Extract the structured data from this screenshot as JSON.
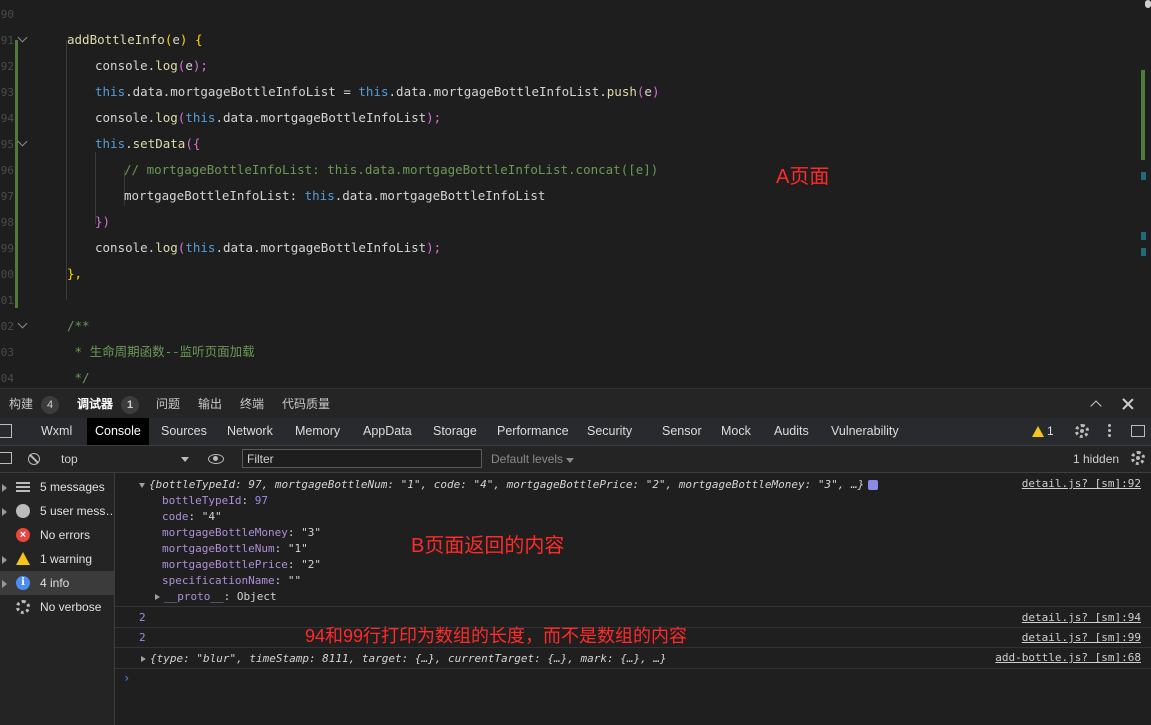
{
  "editor": {
    "line_numbers": [
      "90",
      "91",
      "92",
      "93",
      "94",
      "95",
      "96",
      "97",
      "98",
      "99",
      "00",
      "01",
      "02",
      "03",
      "04"
    ],
    "lines": [
      {
        "segments": [
          {
            "t": "addBottleInfo",
            "c": "fn"
          },
          {
            "t": "(",
            "c": "br1"
          },
          {
            "t": "e",
            "c": "pm"
          },
          {
            "t": ") ",
            "c": "br1"
          },
          {
            "t": "{",
            "c": "br1"
          }
        ]
      },
      {
        "segments": [
          {
            "t": "console.",
            "c": "plain"
          },
          {
            "t": "log",
            "c": "fn"
          },
          {
            "t": "(",
            "c": "br2"
          },
          {
            "t": "e",
            "c": "pm"
          },
          {
            "t": ");",
            "c": "br2"
          }
        ]
      },
      {
        "segments": [
          {
            "t": "this",
            "c": "kw"
          },
          {
            "t": ".data.mortgageBottleInfoList = ",
            "c": "plain"
          },
          {
            "t": "this",
            "c": "kw"
          },
          {
            "t": ".data.mortgageBottleInfoList.",
            "c": "plain"
          },
          {
            "t": "push",
            "c": "fn"
          },
          {
            "t": "(",
            "c": "br2"
          },
          {
            "t": "e",
            "c": "pm"
          },
          {
            "t": ")",
            "c": "br2"
          }
        ]
      },
      {
        "segments": [
          {
            "t": "console.",
            "c": "plain"
          },
          {
            "t": "log",
            "c": "fn"
          },
          {
            "t": "(",
            "c": "br2"
          },
          {
            "t": "this",
            "c": "kw"
          },
          {
            "t": ".data.mortgageBottleInfoList",
            "c": "plain"
          },
          {
            "t": ");",
            "c": "br2"
          }
        ]
      },
      {
        "segments": [
          {
            "t": "this",
            "c": "kw"
          },
          {
            "t": ".",
            "c": "plain"
          },
          {
            "t": "setData",
            "c": "fn"
          },
          {
            "t": "({",
            "c": "br2"
          }
        ]
      },
      {
        "segments": [
          {
            "t": "// mortgageBottleInfoList: this.data.mortgageBottleInfoList.concat([e])",
            "c": "cm"
          }
        ]
      },
      {
        "segments": [
          {
            "t": "mortgageBottleInfoList: ",
            "c": "plain"
          },
          {
            "t": "this",
            "c": "kw"
          },
          {
            "t": ".data.mortgageBottleInfoList",
            "c": "plain"
          }
        ]
      },
      {
        "segments": [
          {
            "t": "})",
            "c": "br2"
          }
        ]
      },
      {
        "segments": [
          {
            "t": "console.",
            "c": "plain"
          },
          {
            "t": "log",
            "c": "fn"
          },
          {
            "t": "(",
            "c": "br2"
          },
          {
            "t": "this",
            "c": "kw"
          },
          {
            "t": ".data.mortgageBottleInfoList",
            "c": "plain"
          },
          {
            "t": ");",
            "c": "br2"
          }
        ]
      },
      {
        "segments": [
          {
            "t": "},",
            "c": "br1"
          }
        ]
      },
      {
        "segments": [
          {
            "t": "",
            "c": "plain"
          }
        ]
      },
      {
        "segments": [
          {
            "t": "/**",
            "c": "cm"
          }
        ]
      },
      {
        "segments": [
          {
            "t": " * 生命周期函数--监听页面加载",
            "c": "cm"
          }
        ]
      },
      {
        "segments": [
          {
            "t": " */",
            "c": "cm"
          }
        ]
      }
    ],
    "annotation": "A页面"
  },
  "tooltabs": {
    "build": "构建",
    "build_count": "4",
    "debugger": "调试器",
    "debugger_count": "1",
    "problems": "问题",
    "output": "输出",
    "terminal": "终端",
    "quality": "代码质量"
  },
  "devtabs": {
    "items": [
      "Wxml",
      "Console",
      "Sources",
      "Network",
      "Memory",
      "AppData",
      "Storage",
      "Performance",
      "Security",
      "Sensor",
      "Mock",
      "Audits",
      "Vulnerability"
    ],
    "warning_count": "1"
  },
  "console_toolbar": {
    "context": "top",
    "filter_placeholder": "Filter",
    "levels": "Default levels",
    "hidden": "1 hidden"
  },
  "sidebar": {
    "items": [
      {
        "label": "5 messages",
        "icon": "list-icon"
      },
      {
        "label": "5 user mess…",
        "icon": "user-icon"
      },
      {
        "label": "No errors",
        "icon": "error-icon"
      },
      {
        "label": "1 warning",
        "icon": "warning-icon"
      },
      {
        "label": "4 info",
        "icon": "info-icon"
      },
      {
        "label": "No verbose",
        "icon": "verbose-icon"
      }
    ]
  },
  "console": {
    "obj_summary": "{bottleTypeId: 97, mortgageBottleNum: \"1\", code: \"4\", mortgageBottlePrice: \"2\", mortgageBottleMoney: \"3\", …}",
    "props": [
      {
        "k": "bottleTypeId",
        "v": "97",
        "t": "num"
      },
      {
        "k": "code",
        "v": "\"4\"",
        "t": "str"
      },
      {
        "k": "mortgageBottleMoney",
        "v": "\"3\"",
        "t": "str"
      },
      {
        "k": "mortgageBottleNum",
        "v": "\"1\"",
        "t": "str"
      },
      {
        "k": "mortgageBottlePrice",
        "v": "\"2\"",
        "t": "str"
      },
      {
        "k": "specificationName",
        "v": "\"\"",
        "t": "str"
      }
    ],
    "proto": "__proto__",
    "proto_val": "Object",
    "link1": "detail.js? [sm]:92",
    "val2": "2",
    "link2": "detail.js? [sm]:94",
    "val3": "2",
    "link3": "detail.js? [sm]:99",
    "event_summary": "{type: \"blur\", timeStamp: 8111, target: {…}, currentTarget: {…}, mark: {…}, …}",
    "link4": "add-bottle.js? [sm]:68",
    "annotation_b": "B页面返回的内容",
    "annotation_c": "94和99行打印为数组的长度，而不是数组的内容"
  }
}
